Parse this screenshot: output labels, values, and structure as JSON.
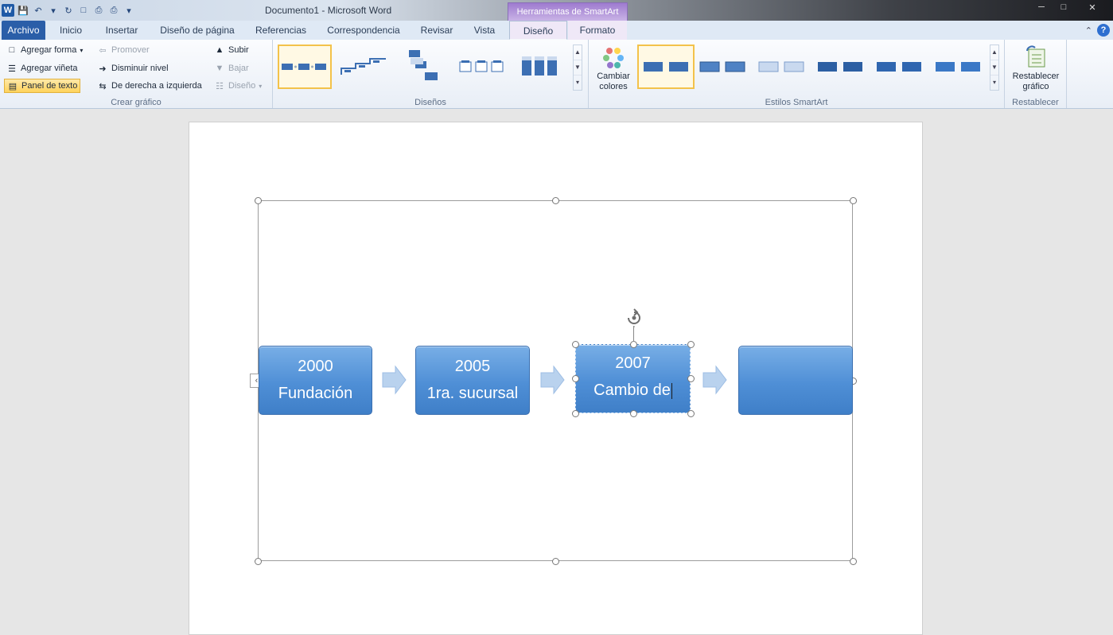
{
  "window": {
    "title": "Documento1  -  Microsoft Word"
  },
  "context_group": {
    "label": "Herramientas de SmartArt"
  },
  "tabs": [
    {
      "label": "Archivo"
    },
    {
      "label": "Inicio"
    },
    {
      "label": "Insertar"
    },
    {
      "label": "Diseño de página"
    },
    {
      "label": "Referencias"
    },
    {
      "label": "Correspondencia"
    },
    {
      "label": "Revisar"
    },
    {
      "label": "Vista"
    },
    {
      "label": "Diseño"
    },
    {
      "label": "Formato"
    }
  ],
  "active_tab": "Diseño",
  "ribbon": {
    "crear_grafico": {
      "label": "Crear gráfico",
      "agregar_forma": "Agregar forma",
      "agregar_vineta": "Agregar viñeta",
      "panel_texto": "Panel de texto",
      "promover": "Promover",
      "disminuir_nivel": "Disminuir nivel",
      "derecha_izquierda": "De derecha a izquierda",
      "subir": "Subir",
      "bajar": "Bajar",
      "diseno": "Diseño"
    },
    "disenos": {
      "label": "Diseños"
    },
    "estilos": {
      "label": "Estilos SmartArt",
      "cambiar_colores": "Cambiar colores"
    },
    "restablecer": {
      "label": "Restablecer",
      "button": "Restablecer gráfico"
    }
  },
  "smartart": {
    "items": [
      {
        "year": "2000",
        "text": "Fundación"
      },
      {
        "year": "2005",
        "text": "1ra. sucursal"
      },
      {
        "year": "2007",
        "text": "Cambio de"
      },
      {
        "year": "",
        "text": ""
      }
    ]
  },
  "colors": {
    "accent": "#2a5ea8",
    "shape": "#4f8fd6",
    "context": "#9e7bcf"
  }
}
